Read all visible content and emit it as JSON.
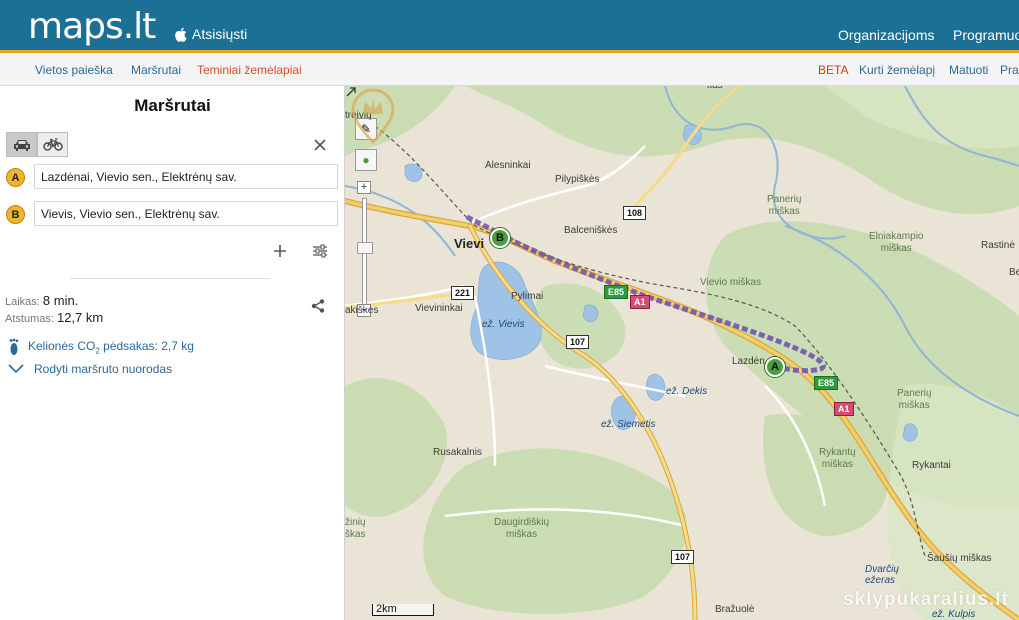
{
  "header": {
    "logo": "maps.lt",
    "download": "Atsisiųsti",
    "nav": [
      "Organizacijoms",
      "Programuo"
    ]
  },
  "subnav": {
    "left": [
      "Vietos paieška",
      "Maršrutai",
      "Teminiai žemėlapiai"
    ],
    "right": [
      "BETA",
      "Kurti žemėlapį",
      "Matuoti",
      "Pra"
    ]
  },
  "panel": {
    "title": "Maršrutai",
    "waypoints": [
      {
        "badge": "A",
        "value": "Lazdėnai, Vievio sen., Elektrėnų sav."
      },
      {
        "badge": "B",
        "value": "Vievis, Vievio sen., Elektrėnų sav."
      }
    ],
    "time_label": "Laikas:",
    "time_value": "8 min.",
    "distance_label": "Atstumas:",
    "distance_value": "12,7 km",
    "co2_text": "Kelionės CO",
    "co2_sub": "2",
    "co2_rest": " pėdsakas: 2,7 kg",
    "directions": "Rodyti maršruto nuorodas"
  },
  "map": {
    "labels": {
      "aleknai": "Alesninkai",
      "pilypiskes": "Pilypiškės",
      "balceniskes": "Balceniškės",
      "vievis": "Vievi",
      "pylimai": "Pylimai",
      "vievininkai": "Vievininkai",
      "akiskes": "akiškės",
      "vievio_miskas": "Vievio miškas",
      "paneriu1": "Panerių\nmiškas",
      "elniakampio": "Elniakampio\nmiškas",
      "rastine": "Rastinė",
      "be": "Be",
      "lazdenai": "Lazdėn",
      "paneriu2": "Panerių\nmiškas",
      "rykantu": "Rykantų\nmiškas",
      "rykantai": "Rykantai",
      "rusakalnis": "Rusakalnis",
      "daugirdiskiu": "Daugirdiškių\nmiškas",
      "ziniu": "žinių\nškas",
      "brazuole": "Bražuolė",
      "sausiu": "Šaušių miškas",
      "dvarciu": "Dvarčių\nežeras",
      "treiviu": "treivių",
      "kas": "kas",
      "kulpis": "ež. Kulpis",
      "lake_vievis": "ež. Vievis",
      "lake_dekis": "ež. Dekis",
      "lake_siemetis": "ež. Siemetis"
    },
    "road_signs": [
      "108",
      "221",
      "107",
      "107",
      "E85",
      "A1",
      "E85",
      "A1"
    ],
    "markers": [
      "A",
      "B"
    ],
    "scale": "2km",
    "watermark": "sklypukaralius.lt"
  },
  "colors": {
    "header": "#1c6f95",
    "accent": "#e6a524",
    "link": "#2a6a9a",
    "route": "#6a4fb3"
  },
  "icons": [
    "apple-icon",
    "car-icon",
    "bicycle-icon",
    "close-icon",
    "plus-icon",
    "options-icon",
    "share-icon",
    "footprint-icon",
    "chevron-down-icon",
    "collapse-icon",
    "zoom-in-icon",
    "zoom-out-icon",
    "expand-icon"
  ]
}
